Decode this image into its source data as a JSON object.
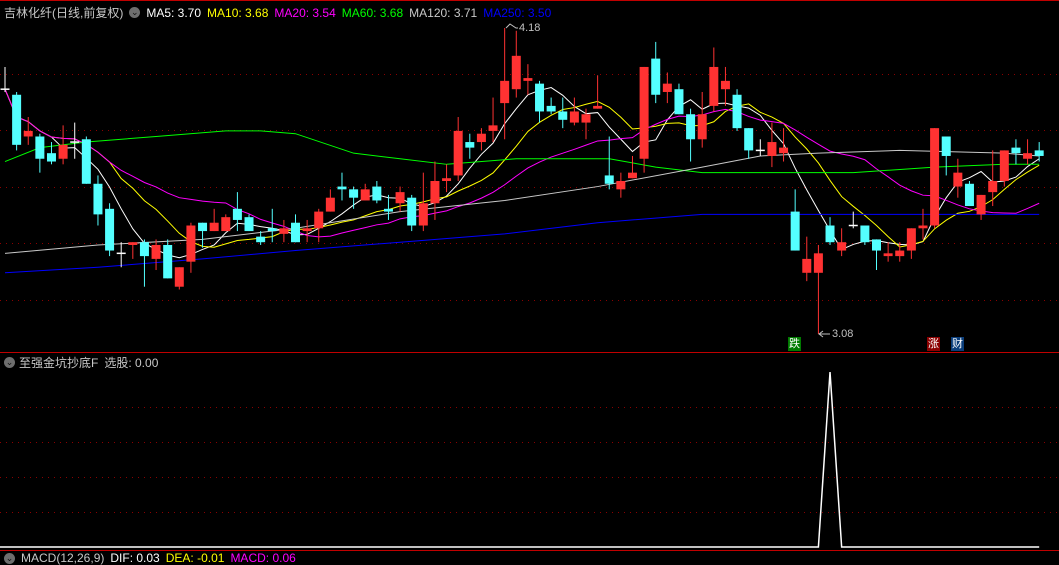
{
  "colors": {
    "up": "#ff3232",
    "down": "#54ffff",
    "doji": "#ffffff",
    "grid": "#8b0000",
    "separator": "#c00000",
    "ma5": "#ffffff",
    "ma10": "#ffff00",
    "ma20": "#ff00ff",
    "ma60": "#00ff00",
    "ma120": "#c8c8c8",
    "ma250": "#0000ff",
    "signal": "#ffffff"
  },
  "header": {
    "title": "吉林化纤(日线,前复权)",
    "ma": [
      {
        "key": "ma5",
        "label": "MA5: 3.70"
      },
      {
        "key": "ma10",
        "label": "MA10: 3.68"
      },
      {
        "key": "ma20",
        "label": "MA20: 3.54"
      },
      {
        "key": "ma60",
        "label": "MA60: 3.68"
      },
      {
        "key": "ma120",
        "label": "MA120: 3.71"
      },
      {
        "key": "ma250",
        "label": "MA250: 3.50"
      }
    ]
  },
  "price_labels": {
    "high": "4.18",
    "low": "3.08"
  },
  "markers": {
    "fall": "跌",
    "rise": "涨",
    "finance": "财"
  },
  "indicator": {
    "title": "至强金坑抄底F",
    "value_label": "选股: 0.00",
    "spike_index": 71
  },
  "macd": {
    "title": "MACD(12,26,9)",
    "dif": "DIF: 0.03",
    "dea": "DEA: -0.01",
    "macd": "MACD: 0.06"
  },
  "chart_data": {
    "type": "candlestick",
    "price_range": [
      3.08,
      4.18
    ],
    "candles_ohlc": [
      [
        3.96,
        4.04,
        3.95,
        3.96
      ],
      [
        3.94,
        3.95,
        3.74,
        3.76
      ],
      [
        3.79,
        3.86,
        3.76,
        3.81
      ],
      [
        3.79,
        3.8,
        3.66,
        3.71
      ],
      [
        3.73,
        3.77,
        3.69,
        3.7
      ],
      [
        3.71,
        3.83,
        3.69,
        3.76
      ],
      [
        3.77,
        3.84,
        3.71,
        3.77
      ],
      [
        3.78,
        3.79,
        3.62,
        3.62
      ],
      [
        3.62,
        3.65,
        3.47,
        3.51
      ],
      [
        3.53,
        3.55,
        3.36,
        3.38
      ],
      [
        3.37,
        3.41,
        3.32,
        3.37
      ],
      [
        3.4,
        3.41,
        3.35,
        3.41
      ],
      [
        3.41,
        3.42,
        3.25,
        3.36
      ],
      [
        3.35,
        3.42,
        3.31,
        3.4
      ],
      [
        3.4,
        3.42,
        3.28,
        3.28
      ],
      [
        3.25,
        3.32,
        3.24,
        3.32
      ],
      [
        3.34,
        3.48,
        3.3,
        3.47
      ],
      [
        3.48,
        3.48,
        3.39,
        3.45
      ],
      [
        3.45,
        3.53,
        3.45,
        3.48
      ],
      [
        3.45,
        3.51,
        3.45,
        3.5
      ],
      [
        3.53,
        3.59,
        3.45,
        3.49
      ],
      [
        3.5,
        3.51,
        3.45,
        3.45
      ],
      [
        3.43,
        3.45,
        3.4,
        3.41
      ],
      [
        3.46,
        3.53,
        3.41,
        3.45
      ],
      [
        3.44,
        3.49,
        3.41,
        3.46
      ],
      [
        3.48,
        3.51,
        3.41,
        3.41
      ],
      [
        3.45,
        3.49,
        3.41,
        3.46
      ],
      [
        3.46,
        3.53,
        3.41,
        3.52
      ],
      [
        3.52,
        3.6,
        3.52,
        3.57
      ],
      [
        3.61,
        3.66,
        3.56,
        3.6
      ],
      [
        3.6,
        3.61,
        3.53,
        3.57
      ],
      [
        3.56,
        3.62,
        3.56,
        3.6
      ],
      [
        3.61,
        3.63,
        3.55,
        3.56
      ],
      [
        3.53,
        3.58,
        3.49,
        3.52
      ],
      [
        3.55,
        3.61,
        3.52,
        3.59
      ],
      [
        3.57,
        3.58,
        3.45,
        3.47
      ],
      [
        3.47,
        3.66,
        3.45,
        3.55
      ],
      [
        3.55,
        3.7,
        3.49,
        3.63
      ],
      [
        3.63,
        3.69,
        3.59,
        3.64
      ],
      [
        3.65,
        3.86,
        3.63,
        3.81
      ],
      [
        3.77,
        3.8,
        3.71,
        3.75
      ],
      [
        3.77,
        3.82,
        3.74,
        3.8
      ],
      [
        3.81,
        3.93,
        3.77,
        3.83
      ],
      [
        3.91,
        4.18,
        3.78,
        3.99
      ],
      [
        3.96,
        4.17,
        3.93,
        4.08
      ],
      [
        3.99,
        4.05,
        3.94,
        4.0
      ],
      [
        3.98,
        3.99,
        3.84,
        3.88
      ],
      [
        3.9,
        3.93,
        3.87,
        3.88
      ],
      [
        3.88,
        3.93,
        3.82,
        3.85
      ],
      [
        3.84,
        3.93,
        3.83,
        3.88
      ],
      [
        3.84,
        3.89,
        3.78,
        3.87
      ],
      [
        3.89,
        4.01,
        3.89,
        3.9
      ],
      [
        3.65,
        3.79,
        3.6,
        3.62
      ],
      [
        3.6,
        3.66,
        3.57,
        3.63
      ],
      [
        3.64,
        3.72,
        3.64,
        3.66
      ],
      [
        3.71,
        4.04,
        3.66,
        4.04
      ],
      [
        4.07,
        4.13,
        3.91,
        3.94
      ],
      [
        3.95,
        4.02,
        3.91,
        3.98
      ],
      [
        3.96,
        3.98,
        3.87,
        3.87
      ],
      [
        3.87,
        3.89,
        3.7,
        3.78
      ],
      [
        3.78,
        3.95,
        3.75,
        3.87
      ],
      [
        3.9,
        4.11,
        3.88,
        4.04
      ],
      [
        3.96,
        4.04,
        3.9,
        3.99
      ],
      [
        3.94,
        3.96,
        3.81,
        3.82
      ],
      [
        3.82,
        3.82,
        3.71,
        3.74
      ],
      [
        3.74,
        3.78,
        3.72,
        3.74
      ],
      [
        3.72,
        3.84,
        3.68,
        3.77
      ],
      [
        3.73,
        3.82,
        3.7,
        3.75
      ],
      [
        3.52,
        3.6,
        3.38,
        3.38
      ],
      [
        3.3,
        3.43,
        3.27,
        3.35
      ],
      [
        3.3,
        3.4,
        3.08,
        3.37
      ],
      [
        3.47,
        3.5,
        3.4,
        3.41
      ],
      [
        3.38,
        3.46,
        3.36,
        3.41
      ],
      [
        3.47,
        3.52,
        3.46,
        3.47
      ],
      [
        3.47,
        3.47,
        3.4,
        3.41
      ],
      [
        3.42,
        3.42,
        3.31,
        3.38
      ],
      [
        3.36,
        3.41,
        3.34,
        3.37
      ],
      [
        3.36,
        3.41,
        3.34,
        3.38
      ],
      [
        3.38,
        3.46,
        3.35,
        3.46
      ],
      [
        3.46,
        3.53,
        3.42,
        3.47
      ],
      [
        3.47,
        3.82,
        3.46,
        3.82
      ],
      [
        3.79,
        3.79,
        3.65,
        3.72
      ],
      [
        3.61,
        3.71,
        3.57,
        3.66
      ],
      [
        3.62,
        3.63,
        3.54,
        3.54
      ],
      [
        3.51,
        3.58,
        3.49,
        3.58
      ],
      [
        3.59,
        3.74,
        3.54,
        3.63
      ],
      [
        3.63,
        3.74,
        3.61,
        3.74
      ],
      [
        3.75,
        3.78,
        3.69,
        3.73
      ],
      [
        3.71,
        3.78,
        3.69,
        3.73
      ],
      [
        3.74,
        3.77,
        3.7,
        3.72
      ]
    ],
    "ma_computed": [
      {
        "key": "ma5",
        "period": 5
      },
      {
        "key": "ma10",
        "period": 10
      },
      {
        "key": "ma20",
        "period": 20
      }
    ],
    "ma_sampled": {
      "ma60": [
        [
          0,
          3.7
        ],
        [
          3,
          3.75
        ],
        [
          7,
          3.77
        ],
        [
          13,
          3.79
        ],
        [
          19,
          3.81
        ],
        [
          22,
          3.81
        ],
        [
          25,
          3.8
        ],
        [
          30,
          3.73
        ],
        [
          34,
          3.71
        ],
        [
          38,
          3.69
        ],
        [
          44,
          3.71
        ],
        [
          48,
          3.71
        ],
        [
          52,
          3.71
        ],
        [
          56,
          3.68
        ],
        [
          60,
          3.66
        ],
        [
          65,
          3.66
        ],
        [
          73,
          3.66
        ],
        [
          80,
          3.68
        ],
        [
          86,
          3.69
        ],
        [
          89,
          3.69
        ]
      ],
      "ma120": [
        [
          0,
          3.37
        ],
        [
          8,
          3.4
        ],
        [
          17,
          3.42
        ],
        [
          25,
          3.46
        ],
        [
          34,
          3.52
        ],
        [
          43,
          3.56
        ],
        [
          51,
          3.61
        ],
        [
          60,
          3.68
        ],
        [
          65,
          3.72
        ],
        [
          70,
          3.73
        ],
        [
          77,
          3.74
        ],
        [
          86,
          3.73
        ],
        [
          89,
          3.72
        ]
      ],
      "ma250": [
        [
          0,
          3.3
        ],
        [
          8,
          3.32
        ],
        [
          17,
          3.35
        ],
        [
          25,
          3.38
        ],
        [
          34,
          3.41
        ],
        [
          43,
          3.44
        ],
        [
          51,
          3.48
        ],
        [
          60,
          3.51
        ],
        [
          68,
          3.51
        ],
        [
          77,
          3.51
        ],
        [
          86,
          3.51
        ],
        [
          89,
          3.51
        ]
      ]
    }
  }
}
